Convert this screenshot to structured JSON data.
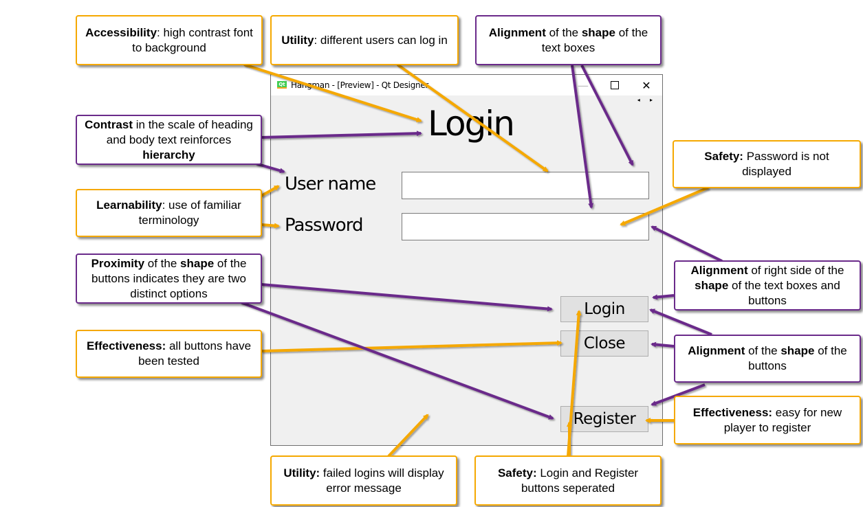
{
  "window": {
    "title": "Hangman - [Preview] - Qt Designer",
    "app_icon": "qt-icon",
    "minimize_glyph": "—",
    "close_glyph": "✕",
    "scroll_arrows": "◂ ▸"
  },
  "form": {
    "heading": "Login",
    "username_label": "User name",
    "username_value": "",
    "password_label": "Password",
    "password_value": "",
    "buttons": {
      "login": "Login",
      "close": "Close",
      "register": "Register"
    }
  },
  "colors": {
    "orange": "#f5a800",
    "purple": "#6a2a8a"
  },
  "callouts": [
    {
      "id": "accessibility",
      "color": "orange",
      "bold": "Accessibility",
      "text": ": high contrast font to background"
    },
    {
      "id": "utility-users",
      "color": "orange",
      "bold": "Utility",
      "text": ": different users can log in"
    },
    {
      "id": "alignment-textboxes",
      "color": "purple",
      "bold": "Alignment",
      "mid": " of the ",
      "bold2": "shape",
      "text": " of the text boxes"
    },
    {
      "id": "contrast",
      "color": "purple",
      "bold": "Contrast",
      "text": " in the scale of heading and body text reinforces ",
      "bold2": "hierarchy"
    },
    {
      "id": "safety-password",
      "color": "orange",
      "bold": "Safety:",
      "text": " Password is not displayed"
    },
    {
      "id": "learnability",
      "color": "orange",
      "bold": "Learnability",
      "text": ": use of familiar terminology"
    },
    {
      "id": "proximity",
      "color": "purple",
      "bold": "Proximity",
      "mid": " of the ",
      "bold2": "shape",
      "text": " of the buttons indicates they are two distinct options"
    },
    {
      "id": "alignment-right",
      "color": "purple",
      "bold": "Alignment",
      "mid": " of right side of the ",
      "bold2": "shape",
      "text": " of the text boxes and buttons"
    },
    {
      "id": "effectiveness-tested",
      "color": "orange",
      "bold": "Effectiveness:",
      "text": " all buttons have been tested"
    },
    {
      "id": "alignment-buttons",
      "color": "purple",
      "bold": "Alignment",
      "mid": " of the ",
      "bold2": "shape",
      "text": " of the buttons"
    },
    {
      "id": "effectiveness-register",
      "color": "orange",
      "bold": "Effectiveness:",
      "text": " easy for new player to register"
    },
    {
      "id": "utility-errors",
      "color": "orange",
      "bold": "Utility:",
      "text": " failed logins will display error message"
    },
    {
      "id": "safety-buttons",
      "color": "orange",
      "bold": "Safety:",
      "text": " Login and Register buttons seperated"
    }
  ]
}
